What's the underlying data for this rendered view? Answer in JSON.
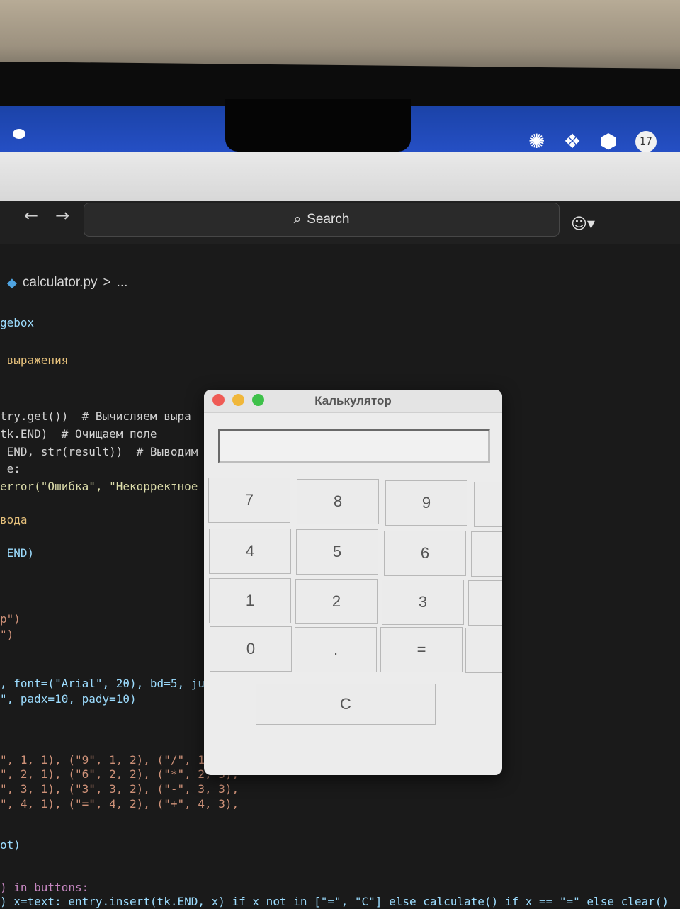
{
  "menubar": {
    "tray_icons": [
      "chatgpt-icon",
      "figma-icon",
      "dropbox-icon",
      "avatar-badge"
    ],
    "badge_text": "17"
  },
  "editor_toolbar": {
    "search_label": "Search"
  },
  "breadcrumb": {
    "file": "calculator.py",
    "separator": ">",
    "more": "..."
  },
  "code_lines": [
    "gebox",
    " выражения",
    "try.get())  # Вычисляем выра",
    "tk.END)  # Очищаем поле",
    " END, str(result))  # Выводим",
    " e:",
    "error(\"Ошибка\", \"Некорректное",
    "вода",
    " END)",
    "p\")",
    "\")",
    ", font=(\"Arial\", 20), bd=5, jus",
    "\", padx=10, pady=10)",
    "\", 1, 1), (\"9\", 1, 2), (\"/\", 1,",
    "\", 2, 1), (\"6\", 2, 2), (\"*\", 2, 3),",
    "\", 3, 1), (\"3\", 3, 2), (\"-\", 3, 3),",
    "\", 4, 1), (\"=\", 4, 2), (\"+\", 4, 3),",
    "ot)",
    ") in buttons:",
    ") x=text: entry.insert(tk.END, x) if x not in [\"=\", \"C\"] else calculate() if x == \"=\" else clear()"
  ],
  "calculator": {
    "title": "Калькулятор",
    "entry_value": "",
    "keys": [
      [
        "7",
        "8",
        "9"
      ],
      [
        "4",
        "5",
        "6"
      ],
      [
        "1",
        "2",
        "3"
      ],
      [
        "0",
        ".",
        "="
      ]
    ],
    "clear_label": "C"
  }
}
